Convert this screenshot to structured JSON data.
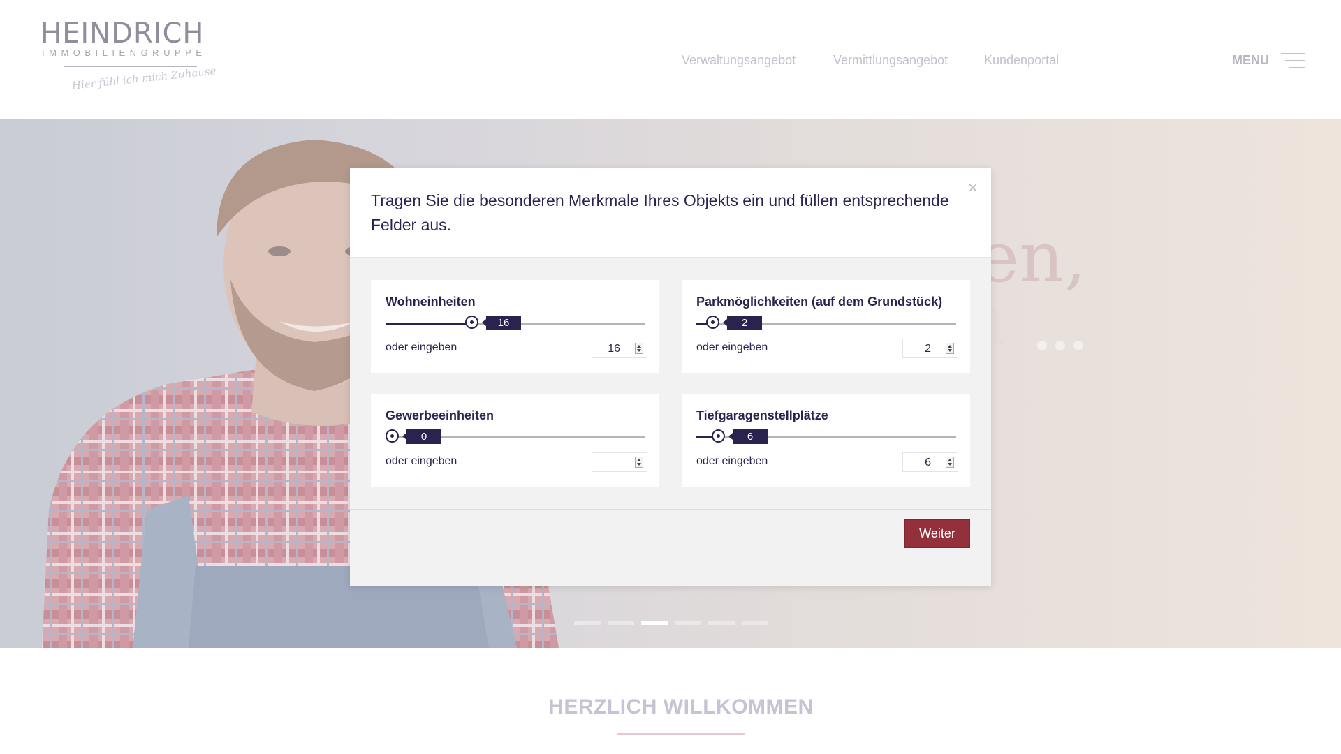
{
  "header": {
    "logo_name": "HEINDRICH",
    "logo_sub": "IMMOBILIENGRUPPE",
    "logo_tagline": "Hier fühl ich mich Zuhause",
    "nav": [
      "Verwaltungsangebot",
      "Vermittlungsangebot",
      "Kundenportal"
    ],
    "menu_label": "MENU"
  },
  "hero": {
    "text_line1": "en,",
    "text_line2": "n",
    "slide_count": 6,
    "active_slide": 3
  },
  "modal": {
    "title": "Tragen Sie die besonderen Merkmale Ihres Objekts ein und füllen entsprechende Felder aus.",
    "close_symbol": "×",
    "fields": [
      {
        "label": "Wohneinheiten",
        "slider_value": "16",
        "input_value": "16",
        "or_label": "oder eingeben"
      },
      {
        "label": "Parkmöglichkeiten (auf dem Grundstück)",
        "slider_value": "2",
        "input_value": "2",
        "or_label": "oder eingeben"
      },
      {
        "label": "Gewerbeeinheiten",
        "slider_value": "0",
        "input_value": "",
        "or_label": "oder eingeben"
      },
      {
        "label": "Tiefgaragenstellplätze",
        "slider_value": "6",
        "input_value": "6",
        "or_label": "oder eingeben"
      }
    ],
    "next_button": "Weiter"
  },
  "section": {
    "welcome": "HERZLICH WILLKOMMEN"
  },
  "colors": {
    "primary": "#2a2350",
    "button": "#93303b"
  }
}
